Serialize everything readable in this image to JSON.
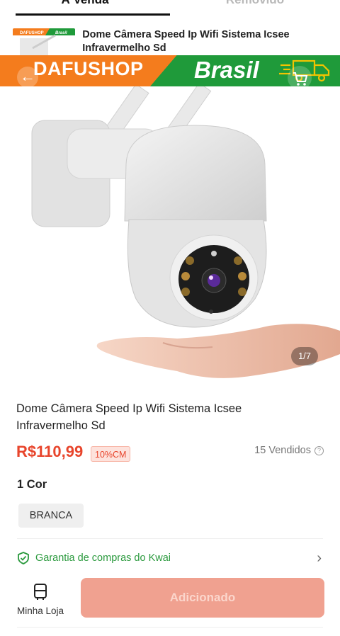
{
  "tabs": [
    {
      "label": "À Venda"
    },
    {
      "label": "Removido"
    }
  ],
  "mini": {
    "title": "Dome Câmera Speed Ip Wifi Sistema Icsee Infravermelho Sd",
    "thumb_left": "DAFUSHOP",
    "thumb_right": "Brasil"
  },
  "banner": {
    "left_text": "DAFUSHOP",
    "right_text": "Brasil",
    "orange": "#f47c1d",
    "green": "#1f9a3a"
  },
  "nav": {
    "back_icon": "arrow-left-icon",
    "cart_icon": "cart-icon"
  },
  "gallery": {
    "indicator": "1/7"
  },
  "product": {
    "title": "Dome Câmera Speed Ip Wifi Sistema Icsee Infravermelho Sd",
    "price": "R$110,99",
    "discount": "10%CM",
    "sold": "15 Vendidos",
    "color_label": "1 Cor",
    "variant": "BRANCA"
  },
  "guarantee": {
    "text": "Garantia de compras do Kwai"
  },
  "bottom": {
    "store_label": "Minha Loja",
    "button_label": "Adicionado"
  },
  "colors": {
    "price": "#e8452c",
    "guarantee": "#2b9a3e",
    "button": "#f0a190"
  }
}
